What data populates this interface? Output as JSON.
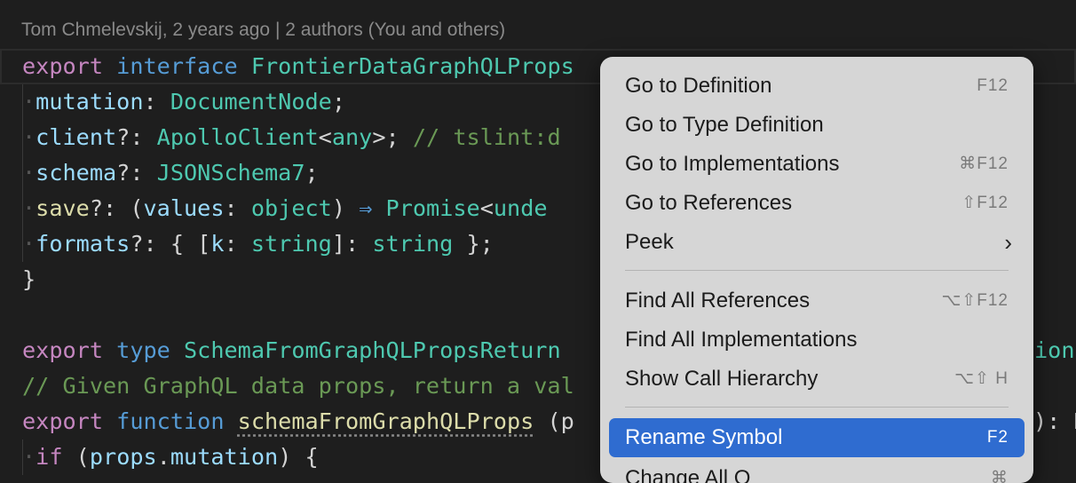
{
  "blame": "Tom Chmelevskij, 2 years ago | 2 authors (You and others)",
  "code": {
    "l1": {
      "kw": "export",
      "kw2": "interface",
      "name": "FrontierDataGraphQLProps"
    },
    "l2": {
      "prop": "mutation",
      "type": "DocumentNode"
    },
    "l3": {
      "prop": "client",
      "type": "ApolloClient",
      "any": "any",
      "comment": "// tslint:d"
    },
    "l4": {
      "prop": "schema",
      "type": "JSONSchema7"
    },
    "l5": {
      "prop": "save",
      "arg": "values",
      "argtype": "object",
      "arrow": "⇒",
      "ret": "Promise",
      "rest": "unde"
    },
    "l6": {
      "prop": "formats",
      "k": "k",
      "ktype": "string",
      "vtype": "string"
    },
    "l7": "}",
    "l9": {
      "kw": "export",
      "kw2": "type",
      "name": "SchemaFromGraphQLPropsReturn",
      "tail": "ionR"
    },
    "l10": {
      "comment": "// Given GraphQL data props, return a val"
    },
    "l11": {
      "kw": "export",
      "kw2": "function",
      "name": "schemaFromGraphQLProps",
      "paren": "(p",
      "tail": "): R"
    },
    "l12": {
      "kw": "if",
      "obj": "props",
      "prop": "mutation"
    }
  },
  "menu": {
    "items": [
      {
        "label": "Go to Definition",
        "shortcut": "F12"
      },
      {
        "label": "Go to Type Definition",
        "shortcut": ""
      },
      {
        "label": "Go to Implementations",
        "shortcut": "⌘F12"
      },
      {
        "label": "Go to References",
        "shortcut": "⇧F12"
      },
      {
        "label": "Peek",
        "shortcut": "›"
      },
      {
        "label": "Find All References",
        "shortcut": "⌥⇧F12"
      },
      {
        "label": "Find All Implementations",
        "shortcut": ""
      },
      {
        "label": "Show Call Hierarchy",
        "shortcut": "⌥⇧ H"
      },
      {
        "label": "Rename Symbol",
        "shortcut": "F2"
      },
      {
        "label": "Change All O",
        "shortcut": "⌘"
      }
    ]
  },
  "colors": {
    "menu_bg": "#d6d6d6",
    "selected": "#2f6cd0",
    "editor_bg": "#1e1e1e"
  }
}
